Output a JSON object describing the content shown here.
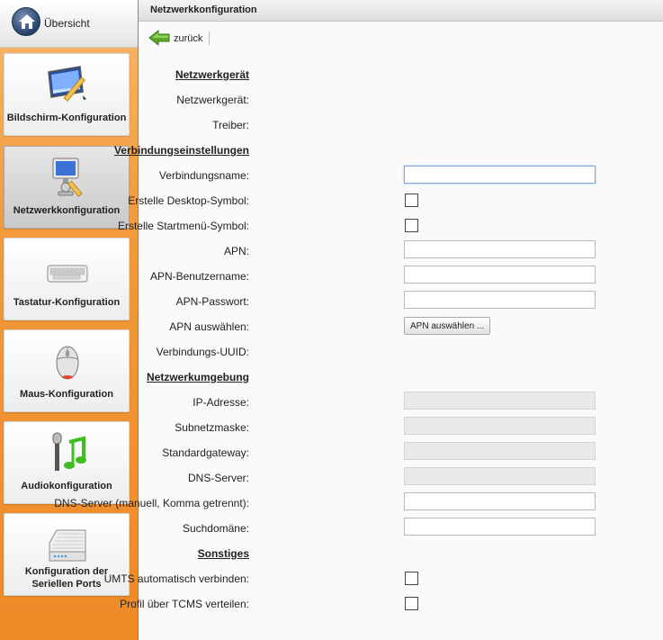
{
  "sidebar": {
    "home_label": "Übersicht",
    "items": [
      {
        "label": "Bildschirm-Konfiguration",
        "icon": "monitor-pencil-icon"
      },
      {
        "label": "Netzwerkkonfiguration",
        "icon": "network-computer-icon",
        "active": true
      },
      {
        "label": "Tastatur-Konfiguration",
        "icon": "keyboard-icon"
      },
      {
        "label": "Maus-Konfiguration",
        "icon": "mouse-icon"
      },
      {
        "label": "Audiokonfiguration",
        "icon": "microphone-music-icon"
      },
      {
        "label_line1": "Konfiguration der",
        "label_line2": "Seriellen Ports",
        "icon": "serial-port-icon"
      }
    ]
  },
  "header": {
    "title": "Netzwerkkonfiguration"
  },
  "toolbar": {
    "back_label": "zurück"
  },
  "form": {
    "section_device": "Netzwerkgerät",
    "device_label": "Netzwerkgerät:",
    "driver_label": "Treiber:",
    "section_connection": "Verbindungseinstellungen",
    "connection_name_label": "Verbindungsname:",
    "connection_name_value": "",
    "desktop_symbol_label": "Erstelle Desktop-Symbol:",
    "desktop_symbol_checked": false,
    "startmenu_symbol_label": "Erstelle Startmenü-Symbol:",
    "startmenu_symbol_checked": false,
    "apn_label": "APN:",
    "apn_value": "",
    "apn_user_label": "APN-Benutzername:",
    "apn_user_value": "",
    "apn_password_label": "APN-Passwort:",
    "apn_password_value": "",
    "apn_select_label": "APN auswählen:",
    "apn_select_button": "APN auswählen ...",
    "uuid_label": "Verbindungs-UUID:",
    "section_environment": "Netzwerkumgebung",
    "ip_label": "IP-Adresse:",
    "subnet_label": "Subnetzmaske:",
    "gateway_label": "Standardgateway:",
    "dns_label": "DNS-Server:",
    "dns_manual_label": "DNS-Server (manuell, Komma getrennt):",
    "dns_manual_value": "",
    "search_domain_label": "Suchdomäne:",
    "search_domain_value": "",
    "section_other": "Sonstiges",
    "umts_label": "UMTS automatisch verbinden:",
    "umts_checked": false,
    "tcms_label": "Profil über TCMS verteilen:",
    "tcms_checked": false
  },
  "colors": {
    "sidebar_orange": "#ee8a26",
    "back_arrow_green": "#5aa82a",
    "focus_blue": "#7ea7d8"
  }
}
